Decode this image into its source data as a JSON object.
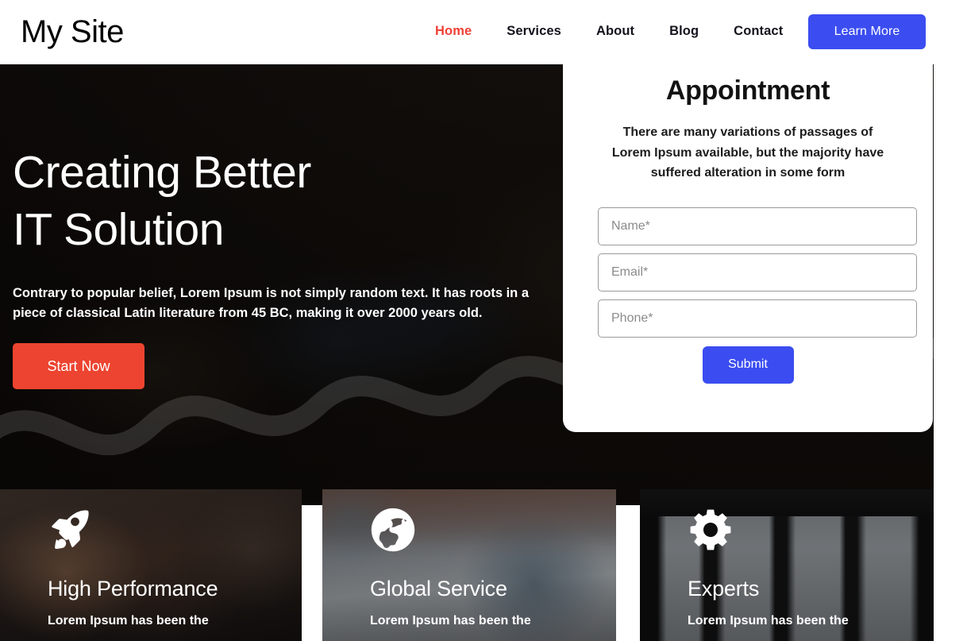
{
  "header": {
    "brand": "My Site",
    "nav": [
      {
        "label": "Home",
        "active": true
      },
      {
        "label": "Services",
        "active": false
      },
      {
        "label": "About",
        "active": false
      },
      {
        "label": "Blog",
        "active": false
      },
      {
        "label": "Contact",
        "active": false
      }
    ],
    "cta_label": "Learn More",
    "cta_color": "#3b4df0",
    "active_color": "#ef4136"
  },
  "hero": {
    "title_line1": "Creating Better",
    "title_line2": "IT Solution",
    "description": "Contrary to popular belief, Lorem Ipsum is not simply random text. It has roots in a piece of classical Latin literature from 45 BC, making it over 2000 years old.",
    "button_label": "Start Now",
    "button_color": "#ec4430"
  },
  "appointment": {
    "title": "Appointment",
    "description": "There are many variations of passages of Lorem Ipsum available, but the majority have suffered alteration in some form",
    "fields": [
      {
        "name": "name",
        "placeholder": "Name*",
        "value": ""
      },
      {
        "name": "email",
        "placeholder": "Email*",
        "value": ""
      },
      {
        "name": "phone",
        "placeholder": "Phone*",
        "value": ""
      }
    ],
    "submit_label": "Submit",
    "submit_color": "#3b4df0"
  },
  "features": [
    {
      "icon": "rocket-icon",
      "title": "High Performance",
      "text": "Lorem Ipsum has been the"
    },
    {
      "icon": "globe-icon",
      "title": "Global Service",
      "text": "Lorem Ipsum has been the"
    },
    {
      "icon": "gear-icon",
      "title": "Experts",
      "text": "Lorem Ipsum has been the"
    }
  ]
}
